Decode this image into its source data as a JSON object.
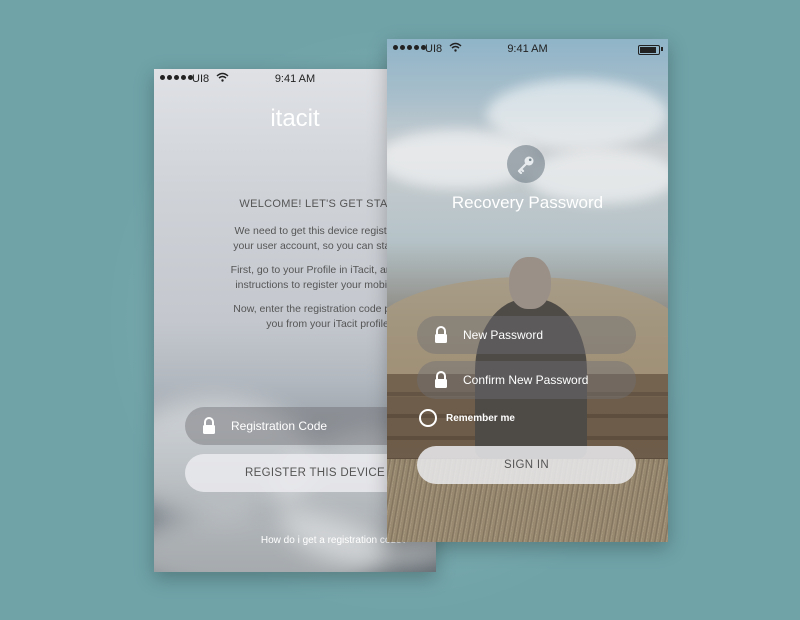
{
  "status_bar_left": {
    "carrier": "UI8",
    "time": "9:41 AM"
  },
  "status_bar_right": {
    "carrier": "UI8",
    "time": "9:41 AM"
  },
  "registration_screen": {
    "brand": "itacit",
    "welcome_title": "WELCOME! LET'S GET STARTED",
    "paragraphs": [
      "We need to get this device registered wit\nyour user account, so you can start using",
      "First, go to your Profile in iTacit, and follow\ninstructions to register your mobile devic",
      "Now, enter the registration code provided\nyou from your iTacit profile."
    ],
    "registration_code_placeholder": "Registration Code",
    "register_button": "REGISTER THIS DEVICE",
    "help_link": "How do i get a registration code?"
  },
  "recovery_screen": {
    "title": "Recovery Password",
    "new_password_placeholder": "New Password",
    "confirm_password_placeholder": "Confirm New Password",
    "remember_me_label": "Remember me",
    "sign_in_button": "SIGN IN"
  },
  "icons": {
    "lock": "lock-icon",
    "key": "key-icon",
    "wifi": "wifi-icon",
    "battery": "battery-icon"
  },
  "colors": {
    "background": "#6fa3a8",
    "field_fill": "rgba(110,110,115,0.45)",
    "button_fill": "rgba(235,235,238,0.85)"
  }
}
